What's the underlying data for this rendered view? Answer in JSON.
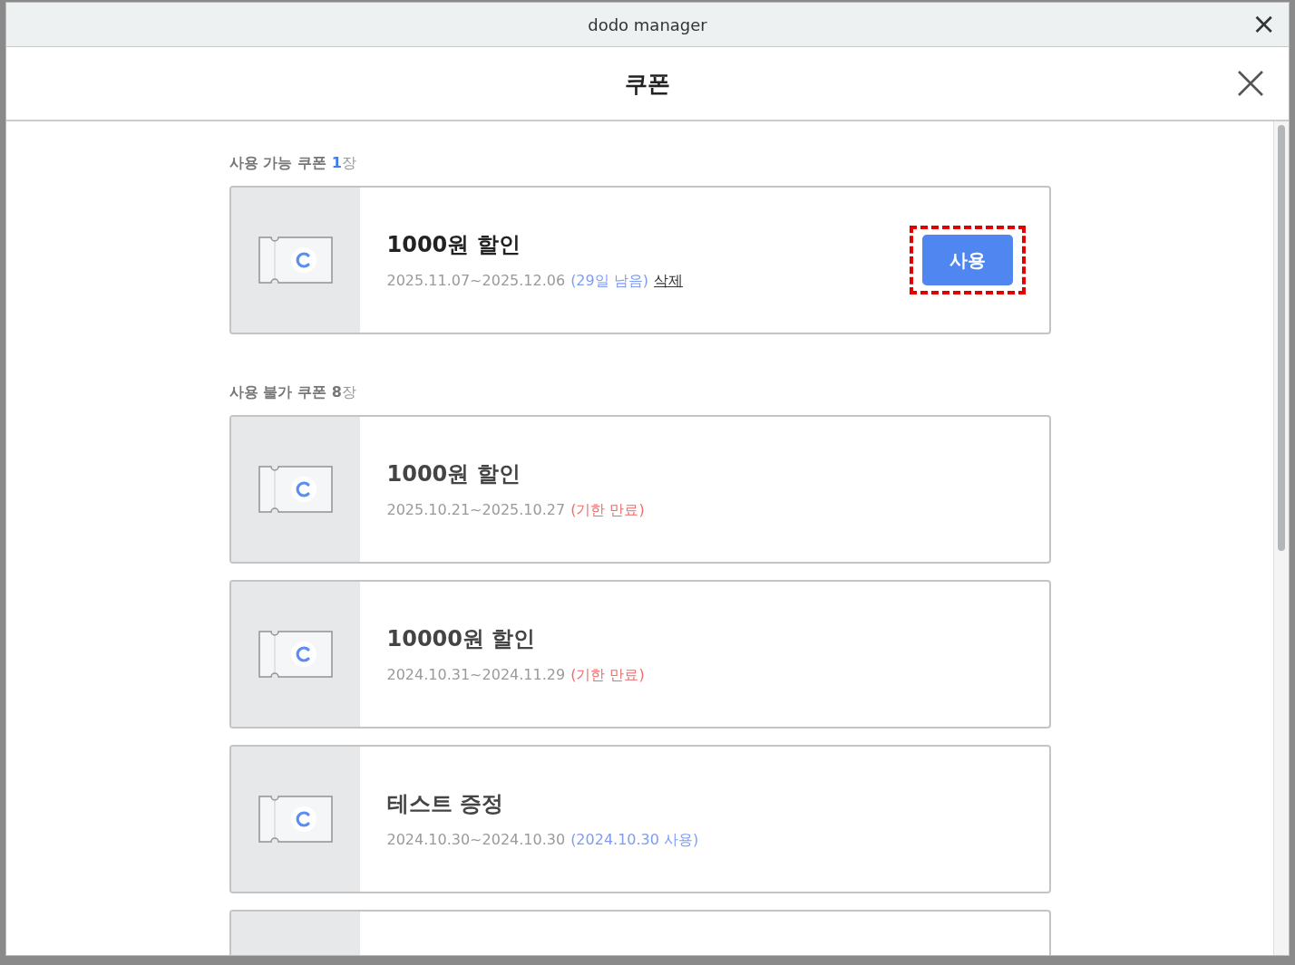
{
  "window": {
    "title": "dodo manager",
    "close": "×"
  },
  "header": {
    "title": "쿠폰"
  },
  "sections": [
    {
      "label": "사용 가능 쿠폰",
      "count": "1",
      "unit": "장",
      "count_highlight": true,
      "coupons": [
        {
          "title": "1000원 할인",
          "period": "2025.11.07~2025.12.06",
          "status": {
            "kind": "remaining",
            "text": "(29일 남음)"
          },
          "delete_link": "삭제",
          "use_button": {
            "label": "사용",
            "highlighted": true
          },
          "dimmed": false
        }
      ]
    },
    {
      "label": "사용 불가 쿠폰",
      "count": "8",
      "unit": "장",
      "count_highlight": false,
      "coupons": [
        {
          "title": "1000원 할인",
          "period": "2025.10.21~2025.10.27",
          "status": {
            "kind": "expired",
            "text": "(기한 만료)"
          },
          "dimmed": true
        },
        {
          "title": "10000원 할인",
          "period": "2024.10.31~2024.11.29",
          "status": {
            "kind": "expired",
            "text": "(기한 만료)"
          },
          "dimmed": true
        },
        {
          "title": "테스트 증정",
          "period": "2024.10.30~2024.10.30",
          "status": {
            "kind": "used",
            "text": "(2024.10.30 사용)"
          },
          "dimmed": true
        }
      ],
      "more_below": true
    }
  ]
}
